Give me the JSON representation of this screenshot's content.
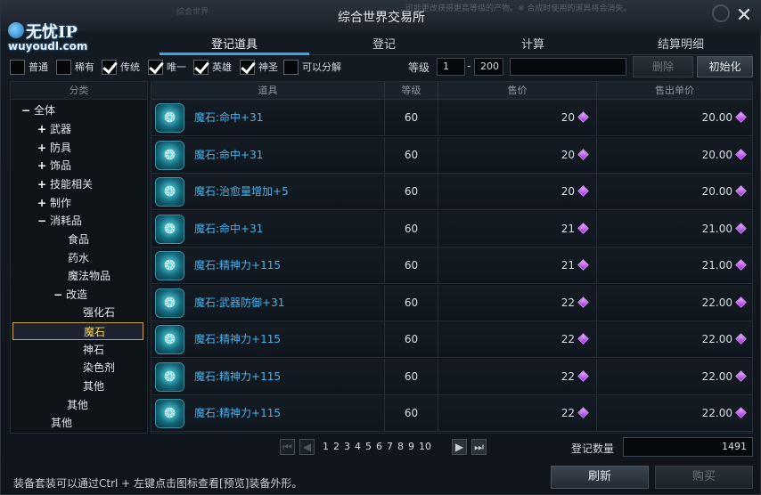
{
  "window": {
    "title": "综合世界交易所",
    "notice": "…可能更改获得更高等级的产物。※ 合成时使用的道具将会消失。",
    "ghost_text": "综合世界"
  },
  "logo": {
    "text_cn": "无忧IP",
    "url": "wuyoudl.com"
  },
  "tabs": [
    {
      "label": "登记道具",
      "active": true
    },
    {
      "label": "登记",
      "active": false
    },
    {
      "label": "计算",
      "active": false
    },
    {
      "label": "结算明细",
      "active": false
    }
  ],
  "filters": [
    {
      "label": "普通",
      "checked": false
    },
    {
      "label": "稀有",
      "checked": false
    },
    {
      "label": "传统",
      "checked": true
    },
    {
      "label": "唯一",
      "checked": true
    },
    {
      "label": "英雄",
      "checked": true
    },
    {
      "label": "神圣",
      "checked": true
    },
    {
      "label": "可以分解",
      "checked": false
    }
  ],
  "level": {
    "label": "等级",
    "min": "1",
    "max": "200",
    "dash": "-",
    "search_value": ""
  },
  "buttons": {
    "delete": "删除",
    "reset": "初始化",
    "refresh": "刷新",
    "buy": "购买"
  },
  "category": {
    "header": "分类",
    "nodes": [
      {
        "label": "全体",
        "toggle": "−"
      },
      {
        "label": "武器",
        "toggle": "+"
      },
      {
        "label": "防具",
        "toggle": "+"
      },
      {
        "label": "饰品",
        "toggle": "+"
      },
      {
        "label": "技能相关",
        "toggle": "+"
      },
      {
        "label": "制作",
        "toggle": "+"
      },
      {
        "label": "消耗品",
        "toggle": "−"
      },
      {
        "label": "食品",
        "toggle": ""
      },
      {
        "label": "药水",
        "toggle": ""
      },
      {
        "label": "魔法物品",
        "toggle": ""
      },
      {
        "label": "改造",
        "toggle": "−"
      },
      {
        "label": "强化石",
        "toggle": ""
      },
      {
        "label": "魔石",
        "toggle": "",
        "selected": true
      },
      {
        "label": "神石",
        "toggle": ""
      },
      {
        "label": "染色剂",
        "toggle": ""
      },
      {
        "label": "其他",
        "toggle": ""
      },
      {
        "label": "其他",
        "toggle": ""
      },
      {
        "label": "其他",
        "toggle": ""
      }
    ]
  },
  "table": {
    "columns": [
      "道具",
      "等级",
      "售价",
      "售出单价"
    ],
    "icon_glyph": "❂",
    "rows": [
      {
        "name": "魔石:命中+31",
        "level": "60",
        "price": "20",
        "unit": "20.00"
      },
      {
        "name": "魔石:命中+31",
        "level": "60",
        "price": "20",
        "unit": "20.00"
      },
      {
        "name": "魔石:治愈量增加+5",
        "level": "60",
        "price": "20",
        "unit": "20.00"
      },
      {
        "name": "魔石:命中+31",
        "level": "60",
        "price": "21",
        "unit": "21.00"
      },
      {
        "name": "魔石:精神力+115",
        "level": "60",
        "price": "21",
        "unit": "21.00"
      },
      {
        "name": "魔石:武器防御+31",
        "level": "60",
        "price": "22",
        "unit": "22.00"
      },
      {
        "name": "魔石:精神力+115",
        "level": "60",
        "price": "22",
        "unit": "22.00"
      },
      {
        "name": "魔石:精神力+115",
        "level": "60",
        "price": "22",
        "unit": "22.00"
      },
      {
        "name": "魔石:精神力+115",
        "level": "60",
        "price": "22",
        "unit": "22.00"
      }
    ]
  },
  "pagination": {
    "first": "⏮",
    "prev": "◀",
    "next": "▶",
    "last": "⏭",
    "pages": [
      "1",
      "2",
      "3",
      "4",
      "5",
      "6",
      "7",
      "8",
      "9",
      "10"
    ]
  },
  "registration": {
    "label": "登记数量",
    "count": "1491"
  },
  "hint": "装备套装可以通过Ctrl + 左键点击图标查看[预览]装备外形。",
  "colors": {
    "accent": "#3aa4e4",
    "item_name": "#47b4ee",
    "selected": "#ffd44e",
    "currency_gem": "#b84cf0"
  }
}
